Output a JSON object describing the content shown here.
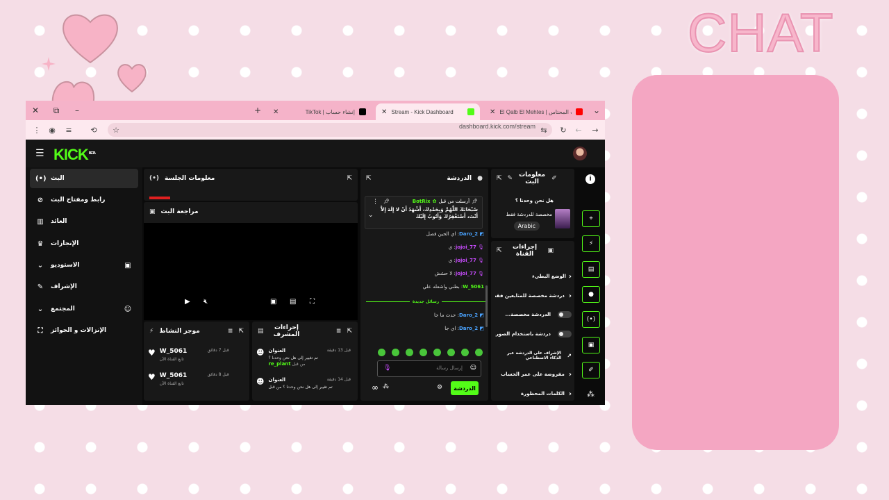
{
  "overlay": {
    "title": "CHAT",
    "colors": {
      "chat_box": "#f4a6c2",
      "background": "#f5dde6",
      "heart": "#f7b3c6"
    }
  },
  "browser": {
    "tabs": [
      {
        "label": "El Qalb El Mehtes | قلب المحتاس",
        "icon": "youtube-icon"
      },
      {
        "label": "Stream - Kick Dashboard",
        "icon": "kick-icon",
        "active": true
      },
      {
        "label": "TikTok | إنشاء حساب",
        "icon": "tiktok-icon"
      }
    ],
    "url": "dashboard.kick.com/stream"
  },
  "kick": {
    "logo": "KICK",
    "logo_badge": "BETA",
    "sidebar": [
      {
        "label": "البث",
        "icon": "broadcast-icon",
        "active": true
      },
      {
        "label": "رابط ومفتاح البث",
        "icon": "link-icon"
      },
      {
        "label": "العائد",
        "icon": "revenue-icon"
      },
      {
        "label": "الإنجازات",
        "icon": "trophy-icon"
      },
      {
        "label": "الاستوديو",
        "icon": "studio-icon",
        "expand": true
      },
      {
        "label": "الإشراف",
        "icon": "wrench-icon"
      },
      {
        "label": "المجتمع",
        "icon": "community-icon",
        "expand": true
      },
      {
        "label": "الإنزالات و الجوائز",
        "icon": "gift-icon"
      }
    ],
    "session_panel": {
      "title": "معلومات الجلسة"
    },
    "preview_panel": {
      "title": "مراجعة البث"
    },
    "activity_panel": {
      "title": "موجز النشاط",
      "items": [
        {
          "user": "W_5061",
          "sub": "تابع القناة الآن",
          "time": "قبل 7 دقائق"
        },
        {
          "user": "W_5061",
          "sub": "تابع القناة الآن",
          "time": "قبل 8 دقائق"
        }
      ]
    },
    "mod_panel": {
      "title": "إجراءات المشرف",
      "items": [
        {
          "title": "العنوان",
          "time": "قبل 13 دقيقة",
          "line1": "تم تغيير إلى هل نحن وحدنا ؟",
          "line2": "من قبل",
          "user": "re_plant"
        },
        {
          "title": "العنوان",
          "time": "قبل 14 دقيقة",
          "line1": "تم تغيير إلى هل نحن وحدنا ؟ من قبل"
        }
      ]
    },
    "chat_panel": {
      "title": "الدردشة",
      "pinned_user": "BotRix",
      "pinned_prefix": "أرسلت من قبل",
      "pinned_text": "سُبْحَانَكَ اللَّهُمَّ وَبِحَمْدِكَ، أَشْهَدُ أَنْ لا إِلَهَ إِلاَّ أَنْتَ، أَسْتَغْفِرُكَ وَأَتُوبُ إِلَيْكَ",
      "messages": [
        {
          "user": "Daro_2",
          "text": "اي الحين فصل",
          "color": "#4aa3ff"
        },
        {
          "user": "jojoi_77",
          "text": "ي",
          "color": "#c94cff"
        },
        {
          "user": "jojoi_77",
          "text": "ي",
          "color": "#c94cff"
        },
        {
          "user": "jojoi_77",
          "text": "لا حشش",
          "color": "#c94cff"
        },
        {
          "user": "W_5061",
          "text": "بطني واشعله علي",
          "color": "#53fc18"
        },
        {
          "user": "Daro_2",
          "text": "حدث ما جا",
          "color": "#4aa3ff"
        },
        {
          "user": "Daro_2",
          "text": "اي جا",
          "color": "#4aa3ff"
        }
      ],
      "new_messages_label": "رسائل جديدة",
      "input_placeholder": "إرسال رسالة",
      "send_label": "الدردشة",
      "infinity": "∞"
    },
    "stream_info": {
      "title": "معلومات البث",
      "stream_title": "هل نحن وحدنا ؟",
      "category": "مخصصة للدردشة فقط",
      "language": "Arabic"
    },
    "channel_actions": {
      "title": "إجراءات القناة",
      "items": [
        {
          "label": "الوضع البطيء",
          "kind": "chev"
        },
        {
          "label": "دردشة مخصصة للمتابعين فقط",
          "kind": "chev"
        },
        {
          "label": "الدردشة مخصصة...",
          "kind": "toggle"
        },
        {
          "label": "دردشة باستخدام الصور...",
          "kind": "toggle"
        },
        {
          "label": "الإشراف على الدردشة عبر الذكاء الاصطناعي",
          "kind": "link"
        },
        {
          "label": "مفروضة على عمر الحساب",
          "kind": "chev"
        },
        {
          "label": "الكلمات المحظورة",
          "kind": "chev"
        }
      ]
    },
    "rail_icons": [
      "info-icon",
      "focus-icon",
      "bolt-icon",
      "notes-icon",
      "chat-bubble-icon",
      "broadcast-icon",
      "layout-icon",
      "wrench-icon",
      "puzzle-icon"
    ]
  }
}
